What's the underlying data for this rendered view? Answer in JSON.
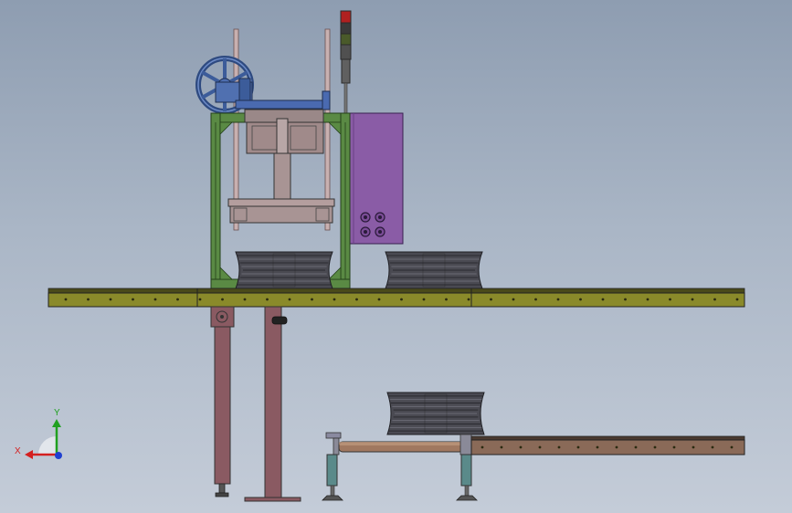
{
  "axes": {
    "x_label": "X",
    "y_label": "Y"
  },
  "colors": {
    "background_top": "#8e9db1",
    "background_bottom": "#c4ccd8",
    "frame_green": "#4f7a3a",
    "rail_olive": "#8a8a2a",
    "lower_rail_brown": "#8a6a58",
    "leg_mauve": "#8a5a62",
    "cabinet_purple": "#8a5ca6",
    "handwheel_blue": "#3c5c9a",
    "wheel_dark": "#3e3e44",
    "signal_red": "#b02020",
    "axis_x": "#d42020",
    "axis_y": "#20a020",
    "axis_z": "#2040d0"
  }
}
